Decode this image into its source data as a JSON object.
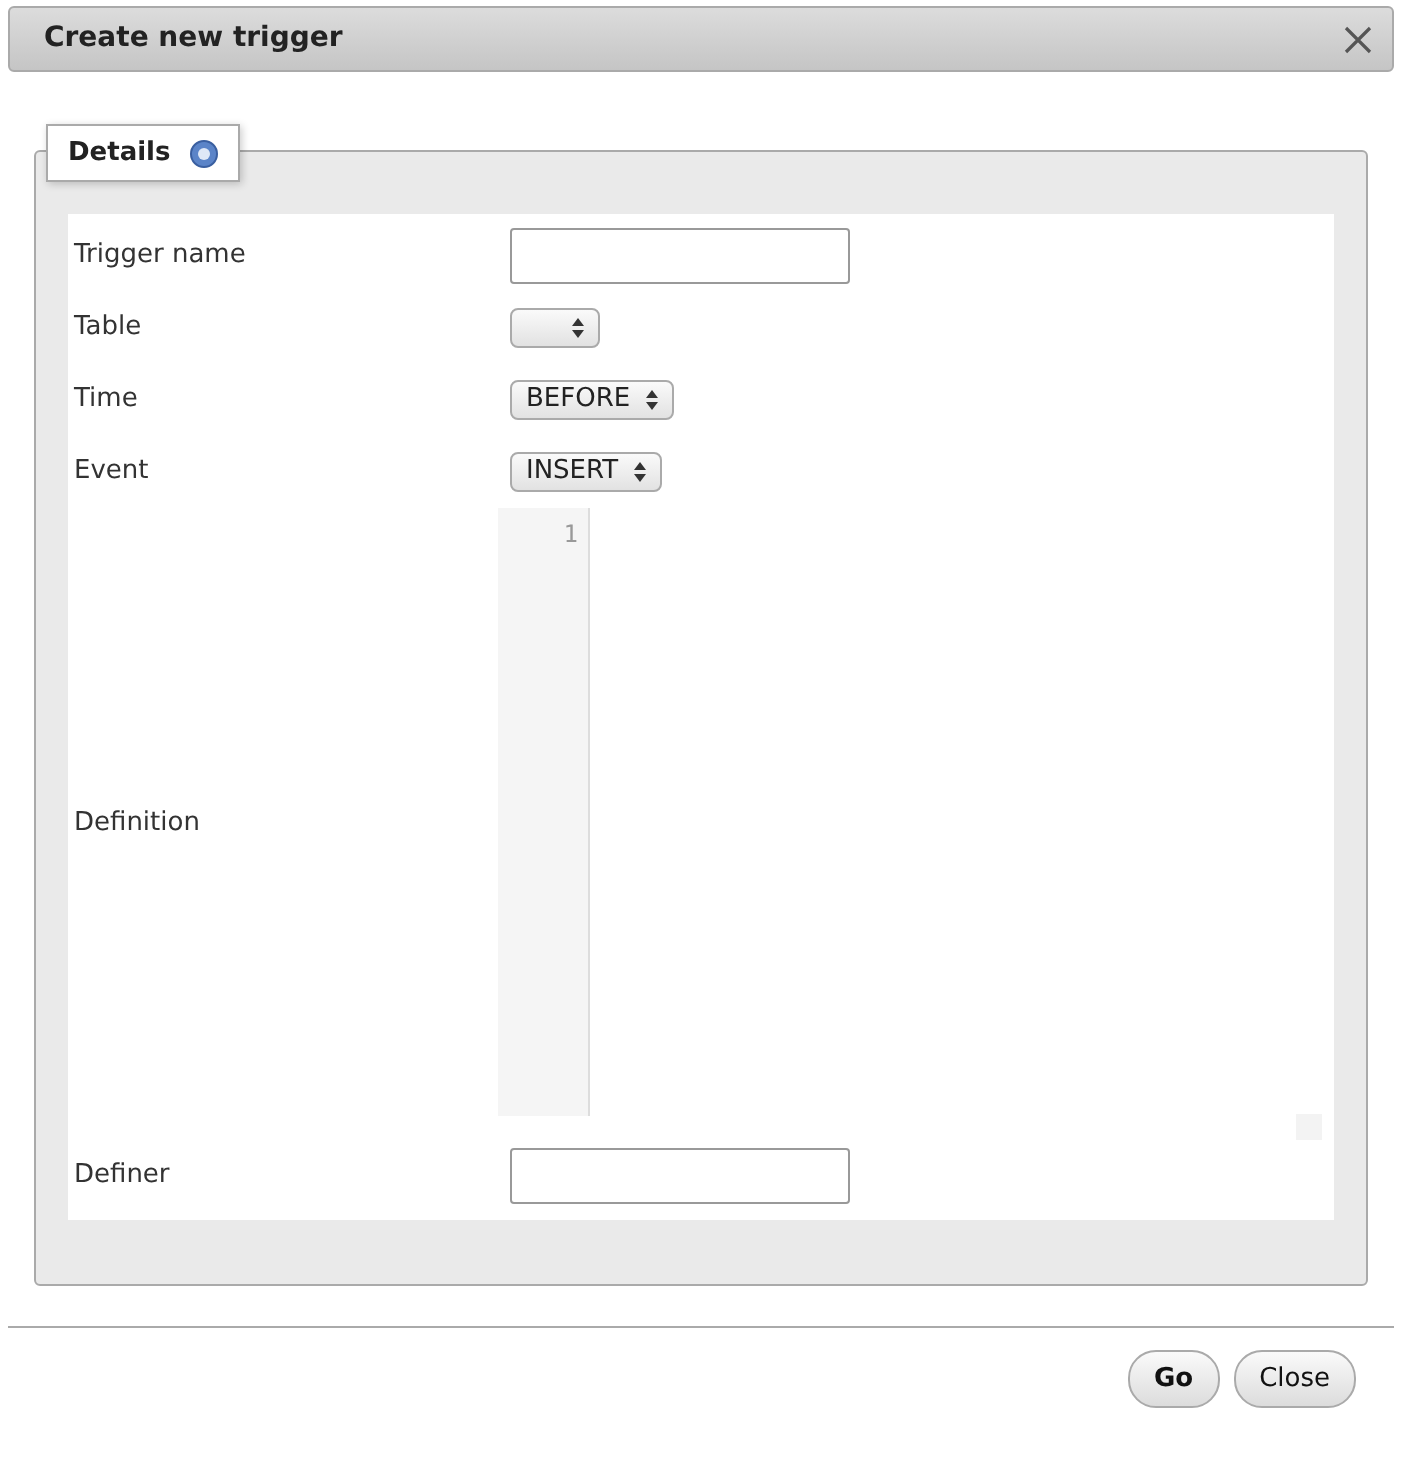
{
  "dialog": {
    "title": "Create new trigger"
  },
  "section": {
    "legend": "Details"
  },
  "fields": [
    {
      "kind": "text",
      "label": "Trigger name"
    },
    {
      "kind": "select",
      "label": "Table"
    },
    {
      "kind": "select",
      "label": "Time",
      "value": "BEFORE"
    },
    {
      "kind": "select",
      "label": "Event",
      "value": "INSERT"
    },
    {
      "kind": "code",
      "label": "Definition",
      "line_numbers": [
        "1"
      ]
    },
    {
      "kind": "text",
      "label": "Definer"
    }
  ],
  "buttons": [
    {
      "label": "Go",
      "primary": true
    },
    {
      "label": "Close",
      "primary": false
    }
  ]
}
